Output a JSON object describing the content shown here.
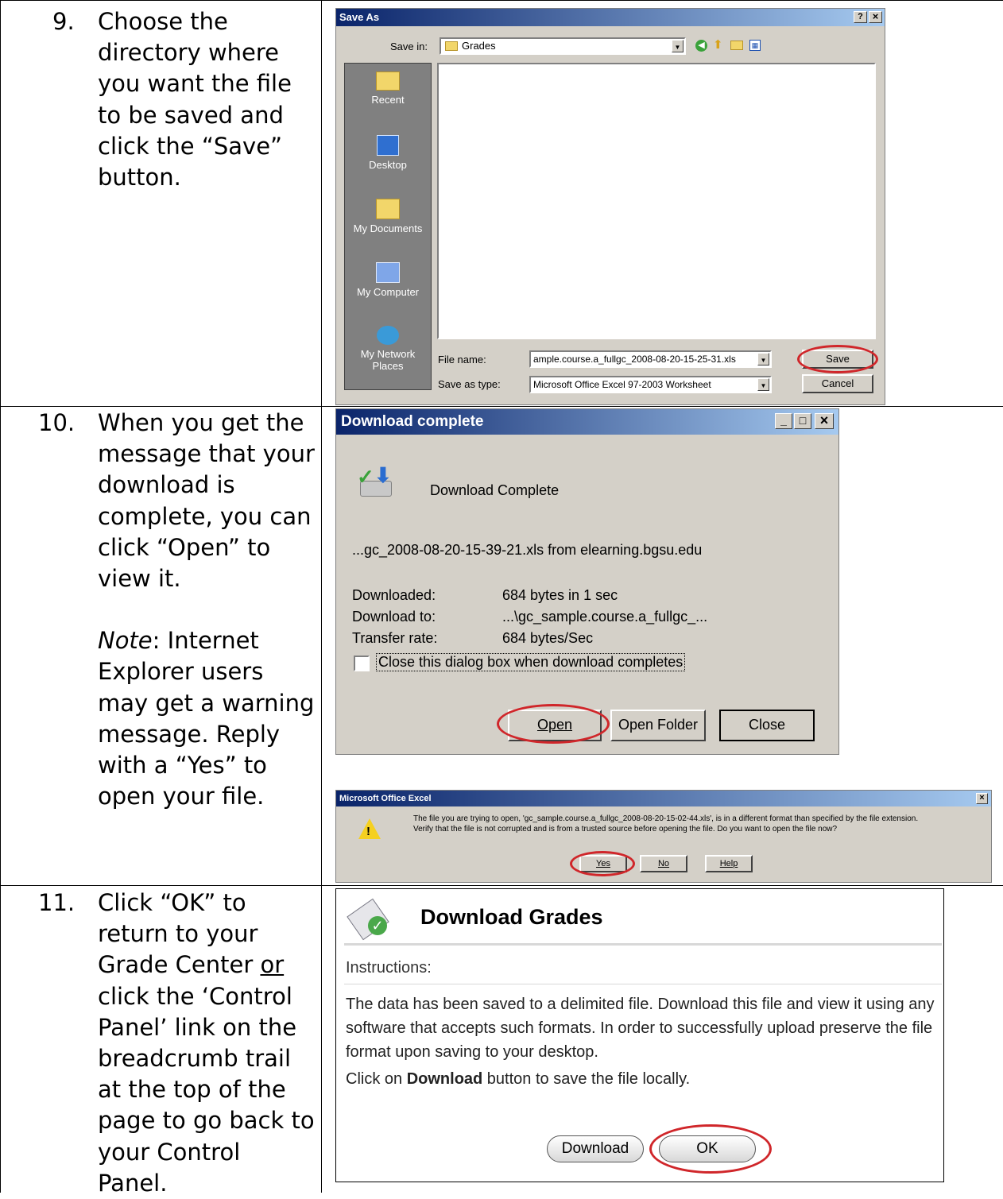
{
  "steps": [
    {
      "number": "9.",
      "text": "Choose the directory where you want the file to be saved and click the “Save” button."
    },
    {
      "number": "10.",
      "text": "When you get the message that your download is complete, you can click “Open” to view it.",
      "note_label": "Note",
      "note_text": ":  Internet Explorer users may get a warning message.  Reply with a “Yes” to open your file."
    },
    {
      "number": "11.",
      "text_parts": [
        "Click “OK” to return to your Grade Center ",
        "or",
        " click the ‘Control Panel’ link on the breadcrumb trail at the top of the page to go back to your Control Panel."
      ]
    }
  ],
  "save_as": {
    "title": "Save As",
    "help_btn": "?",
    "close_btn": "×",
    "save_in_label": "Save in:",
    "save_in_value": "Grades",
    "places": [
      "Recent",
      "Desktop",
      "My Documents",
      "My Computer",
      "My Network Places"
    ],
    "file_name_label": "File name:",
    "file_name_value": "ample.course.a_fullgc_2008-08-20-15-25-31.xls",
    "save_type_label": "Save as type:",
    "save_type_value": "Microsoft Office Excel 97-2003 Worksheet",
    "save_btn": "Save",
    "cancel_btn": "Cancel"
  },
  "download_complete": {
    "title": "Download complete",
    "heading": "Download Complete",
    "source": "...gc_2008-08-20-15-39-21.xls from elearning.bgsu.edu",
    "rows": [
      {
        "label": "Downloaded:",
        "value": "684 bytes in 1 sec"
      },
      {
        "label": "Download to:",
        "value": "...\\gc_sample.course.a_fullgc_..."
      },
      {
        "label": "Transfer rate:",
        "value": "684 bytes/Sec"
      }
    ],
    "checkbox_label": "Close this dialog box when download completes",
    "open_btn": "Open",
    "open_folder_btn": "Open Folder",
    "close_btn": "Close"
  },
  "excel_warning": {
    "title": "Microsoft Office Excel",
    "line1": "The file you are trying to open, 'gc_sample.course.a_fullgc_2008-08-20-15-02-44.xls', is in a different format than specified by the file extension.",
    "line2": "Verify that the file is not corrupted and is from a trusted source before opening the file. Do you want to open the file now?",
    "yes_btn": "Yes",
    "no_btn": "No",
    "help_btn": "Help"
  },
  "download_grades": {
    "title": "Download Grades",
    "instructions_label": "Instructions:",
    "para1": "The data has been saved to a delimited file. Download this file and view it using any software that accepts such formats. In order to successfully upload preserve the file format upon saving to your desktop.",
    "para2_before": "Click on ",
    "para2_bold": "Download",
    "para2_after": " button to save the file locally.",
    "download_btn": "Download",
    "ok_btn": "OK"
  },
  "colors": {
    "title_gradient_start": "#0a246a",
    "title_gradient_end": "#a6caf0",
    "highlight_ring": "#d0262a",
    "dialog_face": "#d4d0c8"
  }
}
